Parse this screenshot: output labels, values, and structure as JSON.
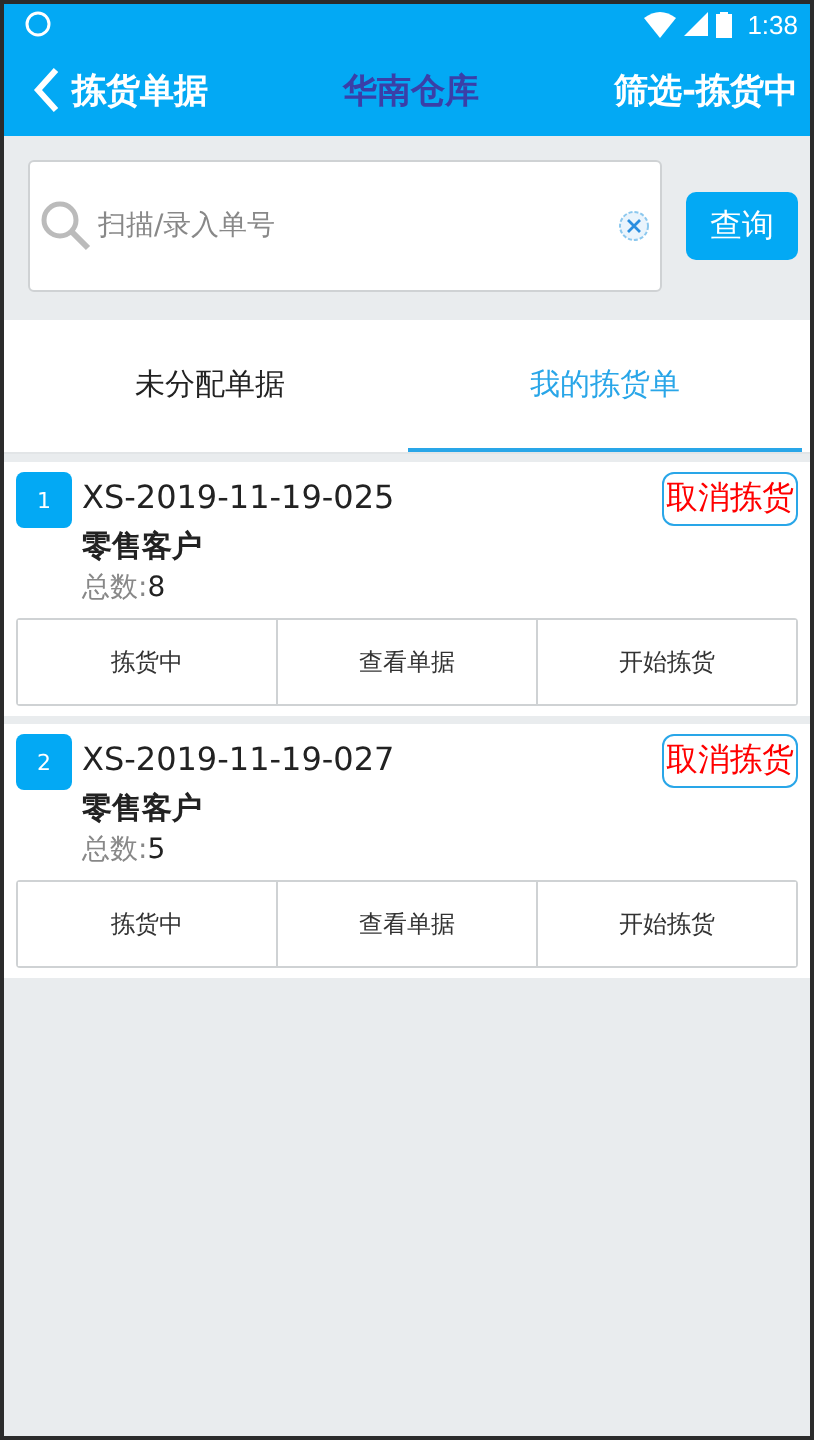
{
  "status_bar": {
    "time": "1:38"
  },
  "header": {
    "back_label": "拣货单据",
    "title": "华南仓库",
    "filter": "筛选-拣货中"
  },
  "search": {
    "placeholder": "扫描/录入单号",
    "button": "查询"
  },
  "tabs": [
    {
      "label": "未分配单据",
      "selected": false
    },
    {
      "label": "我的拣货单",
      "selected": true
    }
  ],
  "orders": [
    {
      "index": "1",
      "order_no": "XS-2019-11-19-025",
      "cancel": "取消拣货",
      "customer": "零售客户",
      "total_label": "总数:",
      "total": "8",
      "actions": [
        "拣货中",
        "查看单据",
        "开始拣货"
      ]
    },
    {
      "index": "2",
      "order_no": "XS-2019-11-19-027",
      "cancel": "取消拣货",
      "customer": "零售客户",
      "total_label": "总数:",
      "total": "5",
      "actions": [
        "拣货中",
        "查看单据",
        "开始拣货"
      ]
    }
  ]
}
